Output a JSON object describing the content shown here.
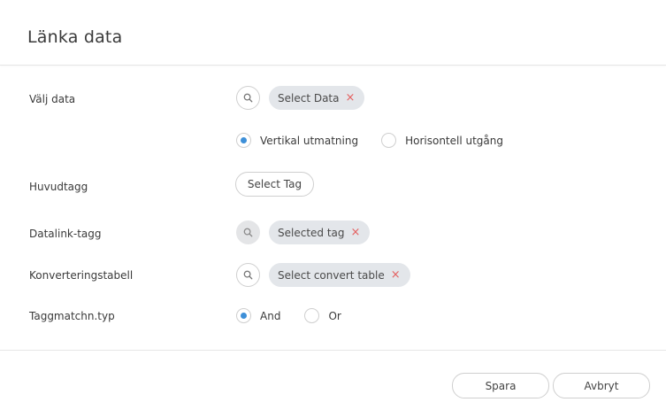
{
  "dialog": {
    "title": "Länka data"
  },
  "rows": {
    "select_data": {
      "label": "Välj data",
      "chip_label": "Select Data",
      "remove_glyph": "×"
    },
    "output": {
      "options": [
        {
          "label": "Vertikal utmatning",
          "selected": true
        },
        {
          "label": "Horisontell utgång",
          "selected": false
        }
      ]
    },
    "main_tag": {
      "label": "Huvudtagg",
      "button_label": "Select Tag"
    },
    "datalink_tag": {
      "label": "Datalink-tagg",
      "chip_label": "Selected tag",
      "remove_glyph": "×"
    },
    "convert_table": {
      "label": "Konverteringstabell",
      "chip_label": "Select convert table",
      "remove_glyph": "×"
    },
    "tag_match": {
      "label": "Taggmatchn.typ",
      "options": [
        {
          "label": "And",
          "selected": true
        },
        {
          "label": "Or",
          "selected": false
        }
      ]
    }
  },
  "footer": {
    "save_label": "Spara",
    "cancel_label": "Avbryt"
  },
  "icons": {
    "search": "search-icon",
    "remove": "close-icon"
  },
  "colors": {
    "accent": "#3d8fd8",
    "remove": "#e46060",
    "chip_bg": "#e3e6ea"
  }
}
